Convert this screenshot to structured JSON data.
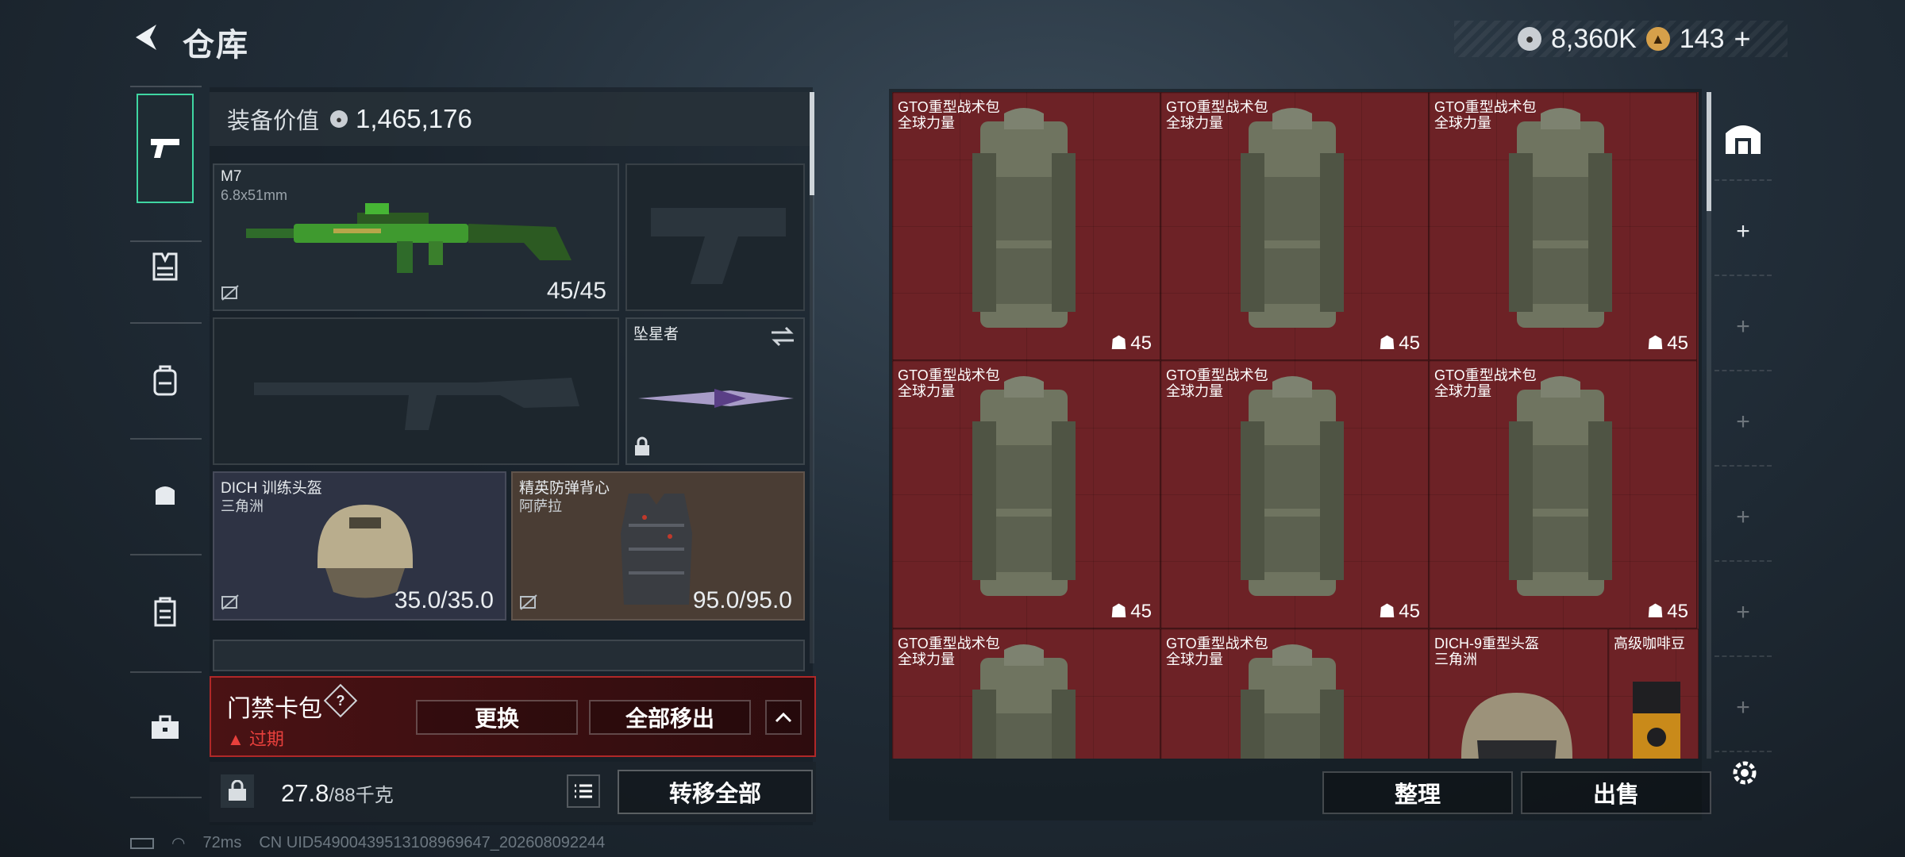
{
  "header": {
    "back_glyph": "<",
    "title": "仓库"
  },
  "currency": {
    "silver_value": "8,360K",
    "gold_value": "143",
    "add_glyph": "+"
  },
  "rail": {
    "items": [
      "weapon-icon",
      "chest-rig-icon",
      "backpack-icon",
      "pouch-icon",
      "case-icon",
      "toolbox-icon"
    ]
  },
  "loadout": {
    "equip_value_label": "装备价值",
    "equip_value": "1,465,176",
    "primary": {
      "name": "M7",
      "ammo": "6.8x51mm",
      "count": "45/45"
    },
    "melee": {
      "name": "坠星者"
    },
    "helmet": {
      "name": "DICH 训练头盔",
      "brand": "三角洲",
      "durability": "35.0/35.0"
    },
    "armor": {
      "name": "精英防弹背心",
      "brand": "阿萨拉",
      "durability": "95.0/95.0"
    }
  },
  "keycard": {
    "title": "门禁卡包",
    "help": "?",
    "status": "过期",
    "replace_label": "更换",
    "remove_all_label": "全部移出"
  },
  "capacity": {
    "value": "27.8",
    "max": "/88千克",
    "transfer_all_label": "转移全部"
  },
  "status_bar": {
    "ping": "72ms",
    "uid": "CN UID5490043951310896964​7_202608092244"
  },
  "storage": {
    "items": [
      {
        "name": "GTO重型战术包",
        "brand": "全球力量",
        "cap": "45"
      },
      {
        "name": "GTO重型战术包",
        "brand": "全球力量",
        "cap": "45"
      },
      {
        "name": "GTO重型战术包",
        "brand": "全球力量",
        "cap": "45"
      },
      {
        "name": "GTO重型战术包",
        "brand": "全球力量",
        "cap": "45"
      },
      {
        "name": "GTO重型战术包",
        "brand": "全球力量",
        "cap": "45"
      },
      {
        "name": "GTO重型战术包",
        "brand": "全球力量",
        "cap": "45"
      },
      {
        "name": "GTO重型战术包",
        "brand": "全球力量",
        "cap": ""
      },
      {
        "name": "GTO重型战术包",
        "brand": "全球力量",
        "cap": ""
      },
      {
        "name": "DICH-9重型头盔",
        "brand": "三角洲",
        "cap": ""
      },
      {
        "name": "高级咖啡豆",
        "brand": "",
        "cap": ""
      }
    ],
    "organize_label": "整理",
    "sell_label": "出售"
  },
  "right_rail": {
    "add_glyph": "+"
  },
  "colors": {
    "accent": "#3fd6a2",
    "storage_bg": "#6d2226",
    "warning": "#e8403c"
  }
}
